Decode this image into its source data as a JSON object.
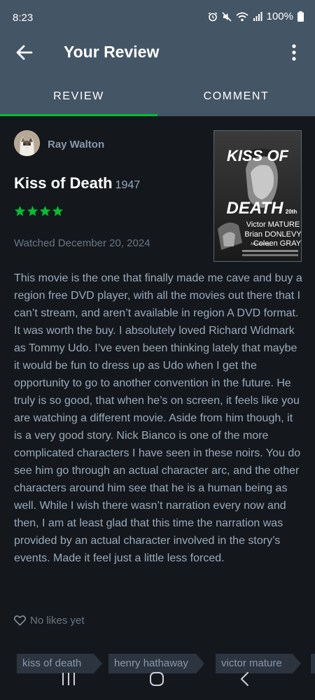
{
  "status_bar": {
    "time": "8:23",
    "battery": "100%"
  },
  "app_bar": {
    "title": "Your Review"
  },
  "tabs": [
    {
      "label": "REVIEW",
      "active": true
    },
    {
      "label": "COMMENT",
      "active": false
    }
  ],
  "review": {
    "reviewer_name": "Ray Walton",
    "movie_title": "Kiss of Death",
    "movie_year": "1947",
    "rating_stars": 4,
    "watched_date": "Watched December 20, 2024",
    "body": "This movie is the one that finally made me cave and buy a region free DVD player, with all the movies out there that I can’t stream, and aren’t available in region A DVD format. It was worth the buy. I absolutely loved Richard Widmark as Tommy Udo. I’ve even been thinking lately that maybe it would be fun to dress up as Udo when I get the opportunity to go to another convention in the future. He truly is so good, that when he’s on screen, it feels like you are watching a different movie. Aside from him though, it is a very good story. Nick Bianco is one of the more complicated characters I have seen in these noirs. You do see him go through an actual character arc, and the other characters around him see that he is a human being as well. While I wish there wasn’t narration every now and then, I am at least glad that this time the narration was provided by an actual character involved in the story’s events. Made it feel just a little less forced.",
    "likes": "No likes yet"
  },
  "poster": {
    "title_line1": "KISS OF",
    "title_line2": "DEATH",
    "studio": "20th",
    "cast": [
      "Victor MATURE",
      "Brian DONLEVY",
      "Coleen GRAY"
    ],
    "introducing": "Introducing"
  },
  "tags": [
    "kiss of death",
    "henry hathaway",
    "victor mature"
  ],
  "colors": {
    "header_bg": "#445566",
    "page_bg": "#14181c",
    "accent_green": "#00c030",
    "text_muted": "#99aabb"
  },
  "icons": {
    "back": "arrow-left-icon",
    "more": "more-vertical-icon",
    "like": "heart-outline-icon",
    "star": "star-icon"
  }
}
